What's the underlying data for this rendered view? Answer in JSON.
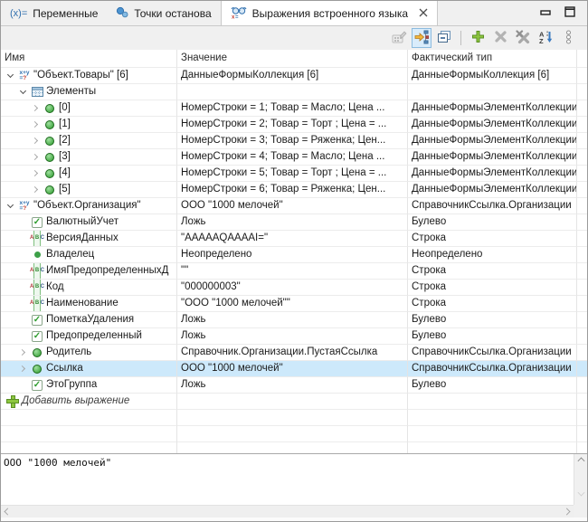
{
  "tabs": [
    {
      "label": "Переменные",
      "icon": "variables-icon",
      "active": false
    },
    {
      "label": "Точки останова",
      "icon": "breakpoints-icon",
      "active": false
    },
    {
      "label": "Выражения встроенного языка",
      "icon": "expressions-icon",
      "active": true,
      "closable": true
    }
  ],
  "window_controls": [
    "minimize",
    "maximize"
  ],
  "toolbar": {
    "buttons": [
      {
        "name": "edit-expression",
        "disabled": true
      },
      {
        "name": "show-in-tree",
        "active": true
      },
      {
        "name": "collapse-all"
      },
      {
        "name": "add-expression"
      },
      {
        "name": "delete-expression",
        "disabled": true
      },
      {
        "name": "delete-all-expressions",
        "disabled": true
      },
      {
        "name": "sort-az"
      },
      {
        "name": "more-options"
      }
    ]
  },
  "table": {
    "columns": [
      "Имя",
      "Значение",
      "Фактический тип"
    ],
    "rows": [
      {
        "name": "\"Объект.Товары\" [6]",
        "value": "ДанныеФормыКоллекция [6]",
        "type": "ДанныеФормыКоллекция [6]",
        "level": 0,
        "expander": "expanded",
        "icon": "formula-icon"
      },
      {
        "name": "Элементы",
        "value": "",
        "type": "",
        "level": 1,
        "expander": "expanded",
        "icon": "collection-icon"
      },
      {
        "name": "[0]",
        "value": "НомерСтроки = 1; Товар = Масло; Цена ...",
        "type": "ДанныеФормыЭлементКоллекции",
        "level": 2,
        "expander": "collapsed",
        "icon": "object-icon"
      },
      {
        "name": "[1]",
        "value": "НомерСтроки = 2; Товар = Торт ; Цена = ...",
        "type": "ДанныеФормыЭлементКоллекции",
        "level": 2,
        "expander": "collapsed",
        "icon": "object-icon"
      },
      {
        "name": "[2]",
        "value": "НомерСтроки = 3; Товар = Ряженка; Цен...",
        "type": "ДанныеФормыЭлементКоллекции",
        "level": 2,
        "expander": "collapsed",
        "icon": "object-icon"
      },
      {
        "name": "[3]",
        "value": "НомерСтроки = 4; Товар = Масло; Цена ...",
        "type": "ДанныеФормыЭлементКоллекции",
        "level": 2,
        "expander": "collapsed",
        "icon": "object-icon"
      },
      {
        "name": "[4]",
        "value": "НомерСтроки = 5; Товар = Торт ; Цена = ...",
        "type": "ДанныеФормыЭлементКоллекции",
        "level": 2,
        "expander": "collapsed",
        "icon": "object-icon"
      },
      {
        "name": "[5]",
        "value": "НомерСтроки = 6; Товар = Ряженка; Цен...",
        "type": "ДанныеФормыЭлементКоллекции",
        "level": 2,
        "expander": "collapsed",
        "icon": "object-icon"
      },
      {
        "name": "\"Объект.Организация\"",
        "value": "ООО \"1000 мелочей\"",
        "type": "СправочникСсылка.Организации",
        "level": 0,
        "expander": "expanded",
        "icon": "formula-icon"
      },
      {
        "name": "ВалютныйУчет",
        "value": "Ложь",
        "type": "Булево",
        "level": 1,
        "icon": "checkbox-icon"
      },
      {
        "name": "ВерсияДанных",
        "value": "\"AAAAAQAAAAI=\"",
        "type": "Строка",
        "level": 1,
        "icon": "string-icon"
      },
      {
        "name": "Владелец",
        "value": "Неопределено",
        "type": "Неопределено",
        "level": 1,
        "icon": "undefined-icon"
      },
      {
        "name": "ИмяПредопределенныхД",
        "value": "\"\"",
        "type": "Строка",
        "level": 1,
        "icon": "string-icon"
      },
      {
        "name": "Код",
        "value": "\"000000003\"",
        "type": "Строка",
        "level": 1,
        "icon": "string-icon"
      },
      {
        "name": "Наименование",
        "value": "\"ООО \"1000 мелочей\"\"",
        "type": "Строка",
        "level": 1,
        "icon": "string-icon"
      },
      {
        "name": "ПометкаУдаления",
        "value": "Ложь",
        "type": "Булево",
        "level": 1,
        "icon": "checkbox-icon"
      },
      {
        "name": "Предопределенный",
        "value": "Ложь",
        "type": "Булево",
        "level": 1,
        "icon": "checkbox-icon"
      },
      {
        "name": "Родитель",
        "value": "Справочник.Организации.ПустаяСсылка",
        "type": "СправочникСсылка.Организации",
        "level": 1,
        "expander": "collapsed",
        "icon": "object-icon"
      },
      {
        "name": "Ссылка",
        "value": "ООО \"1000 мелочей\"",
        "type": "СправочникСсылка.Организации",
        "level": 1,
        "expander": "collapsed",
        "icon": "object-icon",
        "selected": true
      },
      {
        "name": "ЭтоГруппа",
        "value": "Ложь",
        "type": "Булево",
        "level": 1,
        "icon": "checkbox-icon"
      },
      {
        "name": "Добавить выражение",
        "add": true,
        "icon": "add-icon"
      }
    ],
    "empty_row_count": 3
  },
  "preview": {
    "text": "ООО \"1000 мелочей\""
  },
  "colors": {
    "selection": "#cde9fb",
    "accent": "#2f6fae",
    "green": "#3da048",
    "toolbar_active_bg": "#d9ecfb",
    "grid_line": "#e4e4e4"
  }
}
